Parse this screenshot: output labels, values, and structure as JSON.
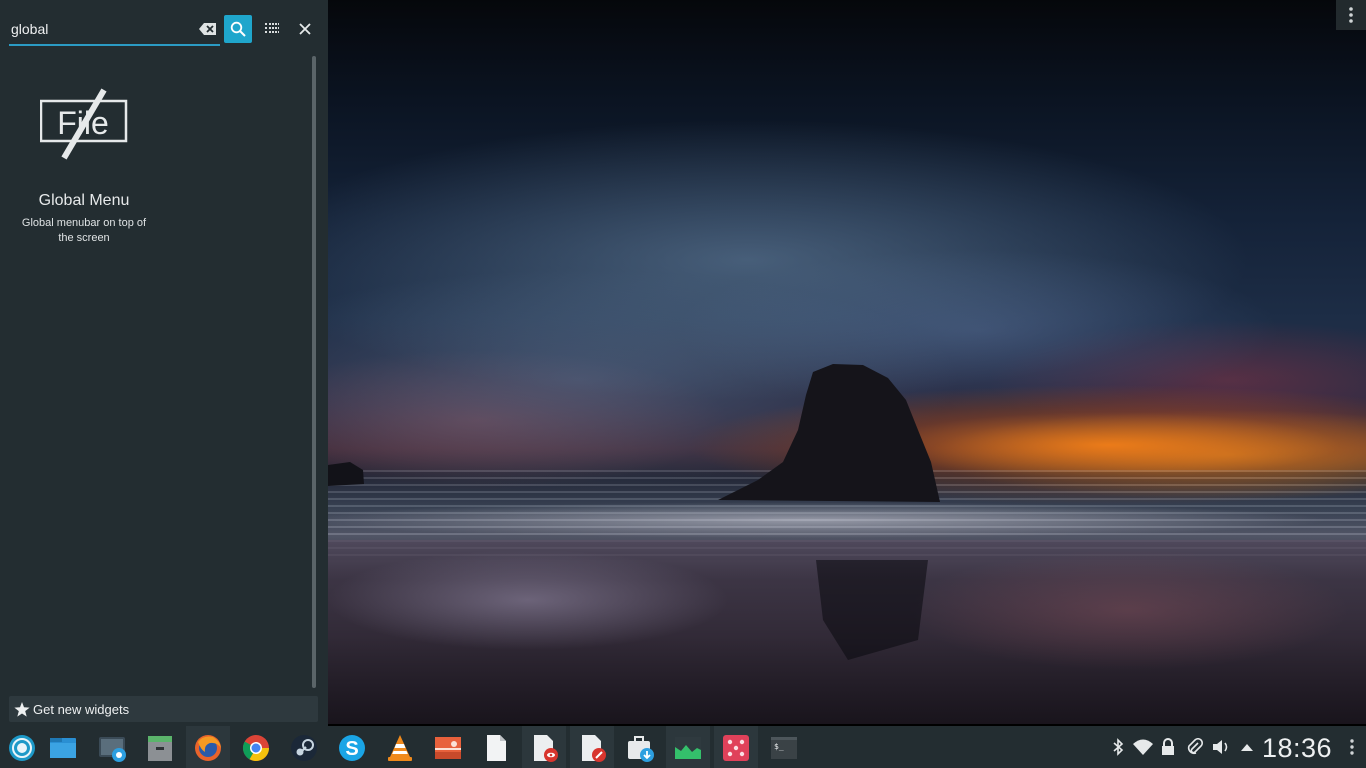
{
  "colors": {
    "panel_bg": "#232d31",
    "accent": "#1fa6cc",
    "text": "#e6e9ea"
  },
  "widget_explorer": {
    "search": {
      "value": "global",
      "clear_icon": "backspace-clear-icon",
      "search_icon": "magnifier-icon"
    },
    "categories_icon": "grid-dots-icon",
    "close_icon": "close-icon",
    "results": [
      {
        "icon": "global-menu-file-icon",
        "icon_text": "File",
        "name": "Global Menu",
        "description": "Global menubar on top of the screen"
      }
    ],
    "get_new": {
      "icon": "star-icon",
      "label": "Get new widgets"
    }
  },
  "desktop": {
    "corner_menu_icon": "vertical-dots-icon"
  },
  "taskbar": {
    "launcher_icon": "application-launcher-icon",
    "tasks": [
      {
        "name": "desktop-folder-icon",
        "active": false
      },
      {
        "name": "screenshot-tool-icon",
        "active": false
      },
      {
        "name": "archive-manager-icon",
        "active": false
      },
      {
        "name": "firefox-icon",
        "active": true
      },
      {
        "name": "chrome-icon",
        "active": false
      },
      {
        "name": "steam-icon",
        "active": false
      },
      {
        "name": "skype-icon",
        "active": false
      },
      {
        "name": "vlc-icon",
        "active": false
      },
      {
        "name": "image-viewer-icon",
        "active": false
      },
      {
        "name": "text-file-icon",
        "active": false
      },
      {
        "name": "document-viewer-icon",
        "active": true
      },
      {
        "name": "document-editor-icon",
        "active": true
      },
      {
        "name": "software-center-icon",
        "active": false
      },
      {
        "name": "system-monitor-icon",
        "active": true
      },
      {
        "name": "dice-game-icon",
        "active": true
      },
      {
        "name": "terminal-icon",
        "active": false
      }
    ],
    "tray": [
      "bluetooth-icon",
      "wifi-icon",
      "lock-icon",
      "attachment-clip-icon",
      "volume-icon",
      "tray-expand-arrow-icon"
    ],
    "clock": "18:36",
    "menu_icon": "vertical-dots-icon"
  }
}
